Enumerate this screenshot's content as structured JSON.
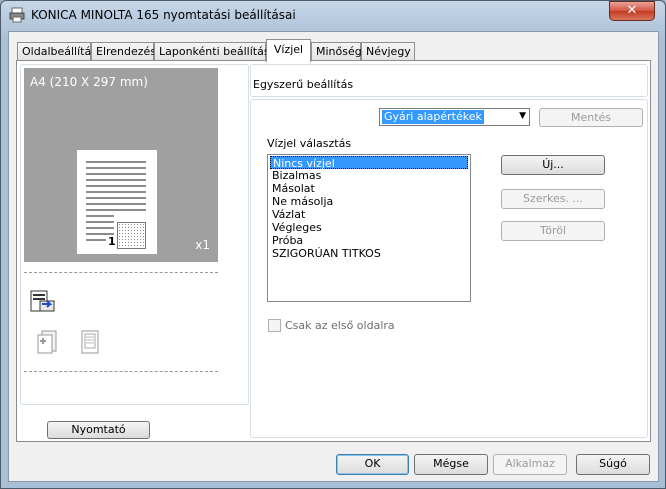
{
  "window": {
    "title": "KONICA MINOLTA 165 nyomtatási beállításai",
    "close_label": "✕"
  },
  "tabs": [
    {
      "label": "Oldalbeállítás"
    },
    {
      "label": "Elrendezés"
    },
    {
      "label": "Laponkénti beállítás"
    },
    {
      "label": "Vízjel",
      "active": true
    },
    {
      "label": "Minőség"
    },
    {
      "label": "Névjegy"
    }
  ],
  "preview": {
    "paper_size": "A4  (210 X 297 mm)",
    "copies": "x1",
    "page_number": "1",
    "printer_button": "Nyomtató"
  },
  "quick_settings": {
    "label": "Egyszerű beállítás",
    "selected": "Gyári alapértékek",
    "save_button": "Mentés"
  },
  "watermark": {
    "group_label": "Vízjel választás",
    "items": [
      "Nincs vízjel",
      "Bizalmas",
      "Másolat",
      "Ne másolja",
      "Vázlat",
      "Végleges",
      "Próba",
      "SZIGORÚAN TITKOS"
    ],
    "selected_index": 0,
    "new_button": "Új...",
    "edit_button": "Szerkes. ...",
    "delete_button": "Töröl",
    "first_page_only": "Csak az első oldalra"
  },
  "footer": {
    "ok": "OK",
    "cancel": "Mégse",
    "apply": "Alkalmaz",
    "help": "Súgó"
  }
}
